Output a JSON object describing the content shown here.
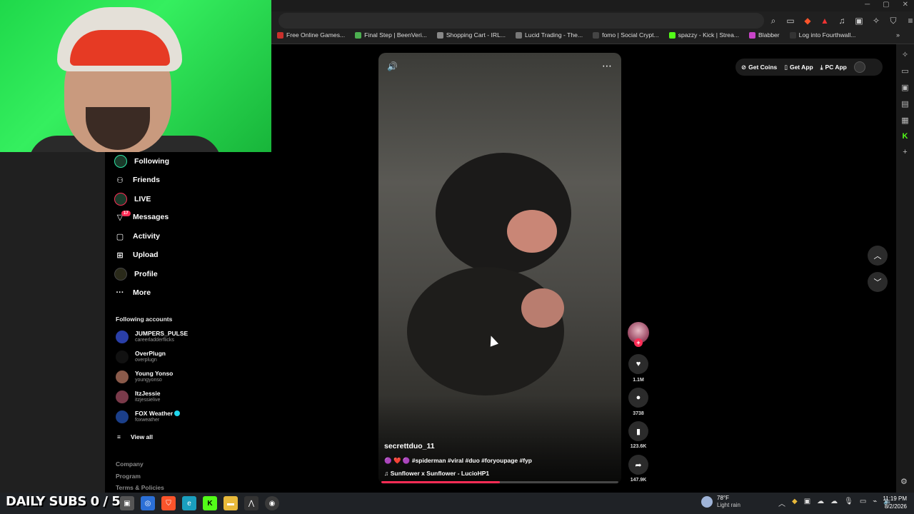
{
  "bookmarks": [
    {
      "label": "Free Online Games...",
      "color": "#c9302c"
    },
    {
      "label": "Final Step | BeenVeri...",
      "color": "#4caf50"
    },
    {
      "label": "Shopping Cart - IRL...",
      "color": "#888888"
    },
    {
      "label": "Lucid Trading - The...",
      "color": "#777777"
    },
    {
      "label": "fomo | Social Crypt...",
      "color": "#444444"
    },
    {
      "label": "spazzy - Kick | Strea...",
      "color": "#53fc18"
    },
    {
      "label": "Blabber",
      "color": "#c844c8"
    },
    {
      "label": "Log into Fourthwall...",
      "color": "#333333"
    }
  ],
  "bookmarks_more": "»",
  "window_controls": [
    "─",
    "▢",
    "✕"
  ],
  "sidebar": {
    "nav": [
      {
        "label": "Following",
        "icon": "following-avatar-icon"
      },
      {
        "label": "Friends",
        "icon": "friends-icon",
        "glyph": "👥"
      },
      {
        "label": "LIVE",
        "icon": "live-icon"
      },
      {
        "label": "Messages",
        "icon": "messages-icon",
        "glyph": "✈"
      },
      {
        "label": "Activity",
        "icon": "activity-icon",
        "glyph": "☐"
      },
      {
        "label": "Upload",
        "icon": "upload-icon",
        "glyph": "⊞"
      },
      {
        "label": "Profile",
        "icon": "profile-icon"
      },
      {
        "label": "More",
        "icon": "more-icon",
        "glyph": "···"
      }
    ],
    "messages_badge": "17",
    "following_header": "Following accounts",
    "accounts": [
      {
        "name": "JUMPERS_PULSE",
        "handle": "careerladderflicks",
        "color": "#2a3fa8",
        "verified": false
      },
      {
        "name": "OverPlugn",
        "handle": "overplugn",
        "color": "#111111",
        "verified": false
      },
      {
        "name": "Young Yonso",
        "handle": "youngyonso",
        "color": "#8a5a4a",
        "verified": false
      },
      {
        "name": "ItzJessie",
        "handle": "itzjessielive",
        "color": "#7a3a4a",
        "verified": false
      },
      {
        "name": "FOX Weather",
        "handle": "foxweather",
        "color": "#1b3f8a",
        "verified": true
      }
    ],
    "view_all": "View all",
    "footer": [
      "Company",
      "Program",
      "Terms & Policies"
    ]
  },
  "video": {
    "author": "secrettduo_11",
    "caption": "🟣 ❤️ 🟣 #spiderman #viral #duo #foryoupage #fyp",
    "music": "♫  Sunflower x Sunflower - LucioHP1",
    "progress": 0.5
  },
  "actions": {
    "likes": "1.1M",
    "comments": "3738",
    "saves": "123.6K",
    "shares": "147.9K"
  },
  "top_actions": {
    "get_coins": "Get Coins",
    "get_app": "Get App",
    "pc_app": "PC App"
  },
  "stream_overlay": {
    "daily_subs": "DAILY SUBS 0 / 5"
  },
  "taskbar": {
    "weather_temp": "78°F",
    "weather_desc": "Light rain",
    "weather_badge": "1",
    "time": "11:19 PM",
    "date": "8/2/2026"
  }
}
